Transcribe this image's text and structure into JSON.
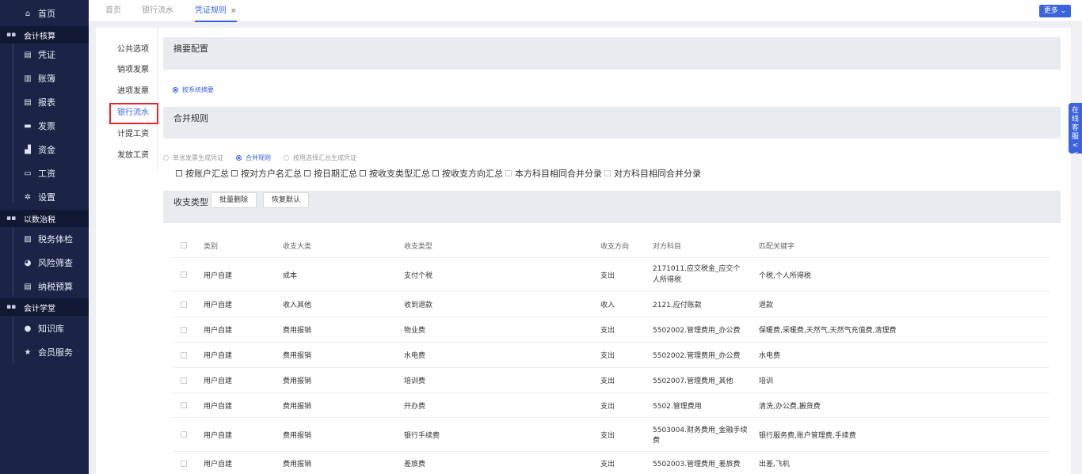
{
  "sidebar": {
    "items": [
      {
        "label": "首页",
        "icon": "home-icon",
        "glyph": "⌂",
        "type": "item"
      },
      {
        "label": "会计核算",
        "icon": "grid-icon",
        "glyph": "▪▪",
        "type": "section"
      },
      {
        "label": "凭证",
        "icon": "voucher-icon",
        "glyph": "▤",
        "type": "sub"
      },
      {
        "label": "账簿",
        "icon": "ledger-icon",
        "glyph": "▥",
        "type": "sub"
      },
      {
        "label": "报表",
        "icon": "report-icon",
        "glyph": "▤",
        "type": "sub"
      },
      {
        "label": "发票",
        "icon": "invoice-icon",
        "glyph": "▬",
        "type": "sub"
      },
      {
        "label": "资金",
        "icon": "fund-icon",
        "glyph": "▟",
        "type": "sub"
      },
      {
        "label": "工资",
        "icon": "salary-icon",
        "glyph": "▭",
        "type": "sub"
      },
      {
        "label": "设置",
        "icon": "gear-icon",
        "glyph": "✲",
        "type": "sub"
      },
      {
        "label": "以数治税",
        "icon": "grid-icon",
        "glyph": "▪▪",
        "type": "section"
      },
      {
        "label": "税务体检",
        "icon": "checkup-icon",
        "glyph": "▨",
        "type": "sub"
      },
      {
        "label": "风险筛查",
        "icon": "risk-icon",
        "glyph": "◕",
        "type": "sub"
      },
      {
        "label": "纳税预算",
        "icon": "budget-icon",
        "glyph": "▤",
        "type": "sub"
      },
      {
        "label": "会计学堂",
        "icon": "grid-icon",
        "glyph": "▪▪",
        "type": "section"
      },
      {
        "label": "知识库",
        "icon": "pin-icon",
        "glyph": "●",
        "type": "sub"
      },
      {
        "label": "会员服务",
        "icon": "star-icon",
        "glyph": "★",
        "type": "sub"
      }
    ]
  },
  "tabs": [
    {
      "label": "首页",
      "active": false
    },
    {
      "label": "银行流水",
      "active": false
    },
    {
      "label": "凭证规则",
      "active": true,
      "close": "×"
    }
  ],
  "more_label": "更多 ⌄",
  "subnav": [
    "公共选项",
    "销项发票",
    "进项发票",
    "银行流水",
    "计提工资",
    "发放工资"
  ],
  "subnav_active": "银行流水",
  "summary": {
    "title": "摘要配置",
    "radio": "按系统摘要"
  },
  "merge": {
    "title": "合并规则",
    "radios": [
      {
        "label": "单张发票生成凭证",
        "on": false
      },
      {
        "label": "合并规则",
        "on": true
      },
      {
        "label": "按用选择汇总生成凭证",
        "on": false
      }
    ],
    "checks": [
      {
        "label": "按账户汇总",
        "dim": false
      },
      {
        "label": "按对方户名汇总",
        "dim": false
      },
      {
        "label": "按日期汇总",
        "dim": false
      },
      {
        "label": "按收支类型汇总",
        "dim": false
      },
      {
        "label": "按收支方向汇总",
        "dim": false
      },
      {
        "label": "本方科目相同合并分录",
        "dim": true
      },
      {
        "label": "对方科目相同合并分录",
        "dim": true
      }
    ]
  },
  "types": {
    "title": "收支类型",
    "batch_delete": "批量删除",
    "restore_default": "恢复默认"
  },
  "table": {
    "headers": [
      "类别",
      "收支大类",
      "收支类型",
      "收支方向",
      "对方科目",
      "匹配关键字"
    ],
    "rows": [
      {
        "c1": "用户自建",
        "c2": "成本",
        "c3": "支付个税",
        "c4": "支出",
        "c5": "2171011.应交税金_应交个人所得税",
        "c6": "个税,个人所得税"
      },
      {
        "c1": "用户自建",
        "c2": "收入其他",
        "c3": "收到退款",
        "c4": "收入",
        "c5": "2121.应付账款",
        "c6": "退款"
      },
      {
        "c1": "用户自建",
        "c2": "费用报销",
        "c3": "物业费",
        "c4": "支出",
        "c5": "5502002.管理费用_办公费",
        "c6": "保暖费,采暖费,天然气,天然气充值费,清理费"
      },
      {
        "c1": "用户自建",
        "c2": "费用报销",
        "c3": "水电费",
        "c4": "支出",
        "c5": "5502002.管理费用_办公费",
        "c6": "水电费"
      },
      {
        "c1": "用户自建",
        "c2": "费用报销",
        "c3": "培训费",
        "c4": "支出",
        "c5": "5502007.管理费用_其他",
        "c6": "培训"
      },
      {
        "c1": "用户自建",
        "c2": "费用报销",
        "c3": "开办费",
        "c4": "支出",
        "c5": "5502.管理费用",
        "c6": "清洗,办公费,搬货费"
      },
      {
        "c1": "用户自建",
        "c2": "费用报销",
        "c3": "银行手续费",
        "c4": "支出",
        "c5": "5503004.财务费用_金融手续费",
        "c6": "银行服务费,账户管理费,手续费"
      },
      {
        "c1": "用户自建",
        "c2": "费用报销",
        "c3": "差旅费",
        "c4": "支出",
        "c5": "5502003.管理费用_差旅费",
        "c6": "出差,飞机"
      }
    ]
  },
  "float_tab": "在线客服 <<",
  "colors": {
    "accent": "#3b63e0",
    "sidebar": "#1b2447",
    "highlight": "#e8262a"
  }
}
